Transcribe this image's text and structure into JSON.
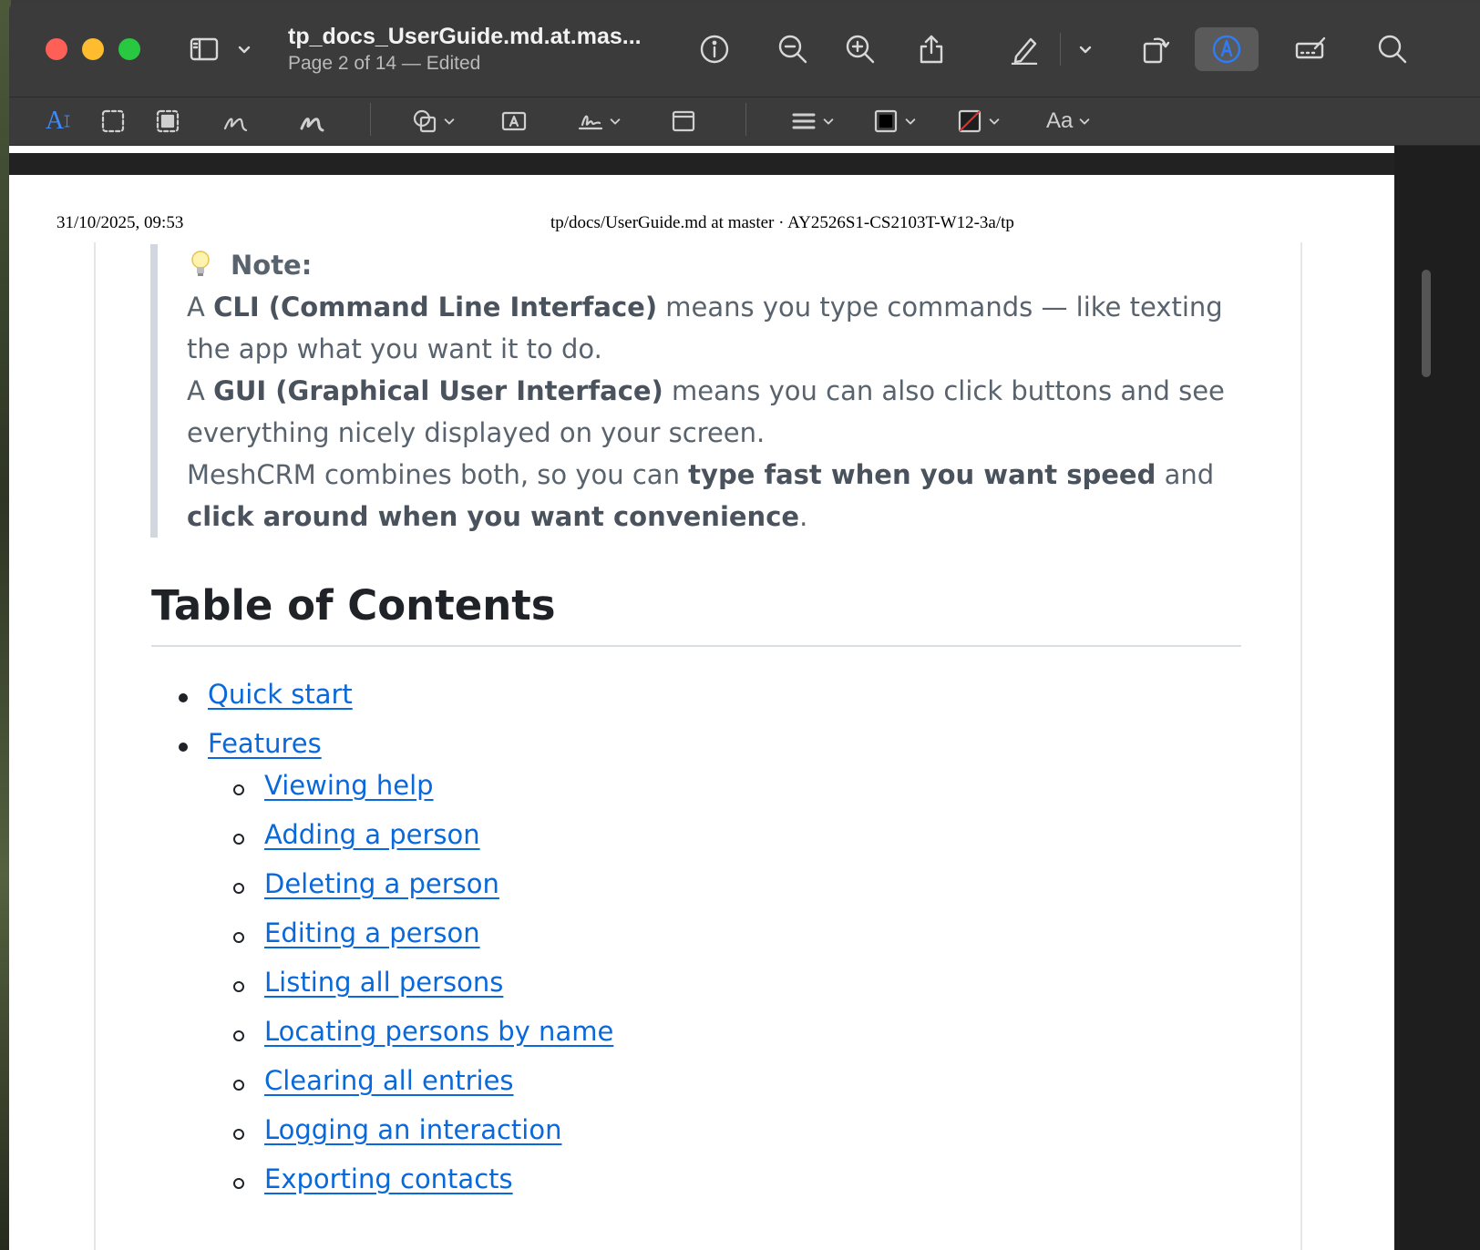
{
  "window": {
    "title": "tp_docs_UserGuide.md.at.mas...",
    "subtitle": "Page 2 of 14 — Edited"
  },
  "toolbar": {
    "icons": [
      "sidebar-icon",
      "chevron-down-icon",
      "info-icon",
      "zoom-out-icon",
      "zoom-in-icon",
      "share-icon",
      "highlight-icon",
      "chevron-down-icon",
      "rotate-icon",
      "markup-icon",
      "form-fill-icon",
      "search-icon"
    ]
  },
  "markup": {
    "text_tool": "A",
    "font_button": "Aa",
    "border_color": "#000000",
    "fill_color": "#e0302a"
  },
  "page": {
    "header_left": "31/10/2025, 09:53",
    "header_center": "tp/docs/UserGuide.md at master · AY2526S1-CS2103T-W12-3a/tp"
  },
  "note": {
    "heading": "Note:",
    "p1_pre": "A ",
    "p1_bold": "CLI (Command Line Interface)",
    "p1_post": " means you type commands — like texting the app what you want it to do.",
    "p2_pre": "A ",
    "p2_bold": "GUI (Graphical User Interface)",
    "p2_post": " means you can also click buttons and see everything nicely displayed on your screen.",
    "p3_pre": "MeshCRM combines both, so you can ",
    "p3_bold1": "type fast when you want speed",
    "p3_mid": " and ",
    "p3_bold2": "click around when you want convenience",
    "p3_post": "."
  },
  "toc": {
    "title": "Table of Contents",
    "top_items": [
      "Quick start",
      "Features"
    ],
    "sub_items": [
      "Viewing help",
      "Adding a person",
      "Deleting a person",
      "Editing a person",
      "Listing all persons",
      "Locating persons by name",
      "Clearing all entries",
      "Logging an interaction",
      "Exporting contacts"
    ]
  }
}
